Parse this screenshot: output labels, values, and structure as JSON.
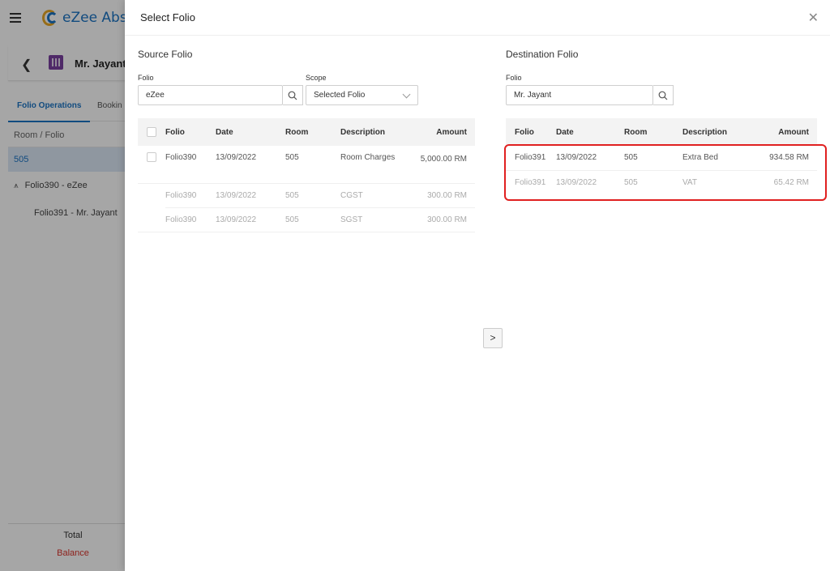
{
  "app": {
    "logo_text": "eZee Absc",
    "guest_name": "Mr. Jayant ť",
    "tabs": [
      "Folio Operations",
      "Bookin"
    ],
    "left_list": {
      "header": "Room / Folio",
      "room": "505",
      "folios": [
        "Folio390 - eZee",
        "Folio391 - Mr. Jayant"
      ]
    },
    "footer": {
      "total": "Total",
      "balance": "Balance"
    }
  },
  "dialog": {
    "title": "Select Folio",
    "source": {
      "section_title": "Source Folio",
      "folio_label": "Folio",
      "folio_value": "eZee",
      "scope_label": "Scope",
      "scope_value": "Selected Folio",
      "columns": [
        "Folio",
        "Date",
        "Room",
        "Description",
        "Amount"
      ],
      "rows": [
        {
          "folio": "Folio390",
          "date": "13/09/2022",
          "room": "505",
          "description": "Room Charges",
          "amount": "5,000.00 RM",
          "checkbox": true,
          "muted": false
        },
        {
          "folio": "Folio390",
          "date": "13/09/2022",
          "room": "505",
          "description": "CGST",
          "amount": "300.00 RM",
          "checkbox": false,
          "muted": true
        },
        {
          "folio": "Folio390",
          "date": "13/09/2022",
          "room": "505",
          "description": "SGST",
          "amount": "300.00 RM",
          "checkbox": false,
          "muted": true
        }
      ]
    },
    "destination": {
      "section_title": "Destination Folio",
      "folio_label": "Folio",
      "folio_value": "Mr. Jayant",
      "columns": [
        "Folio",
        "Date",
        "Room",
        "Description",
        "Amount"
      ],
      "rows": [
        {
          "folio": "Folio391",
          "date": "13/09/2022",
          "room": "505",
          "description": "Extra Bed",
          "amount": "934.58 RM",
          "muted": false
        },
        {
          "folio": "Folio391",
          "date": "13/09/2022",
          "room": "505",
          "description": "VAT",
          "amount": "65.42 RM",
          "muted": true
        }
      ]
    },
    "move_button": ">"
  },
  "colors": {
    "accent": "#1b74c4",
    "highlight": "#e02020",
    "balance": "#d9342b",
    "muted_text": "#aaaaaa"
  }
}
